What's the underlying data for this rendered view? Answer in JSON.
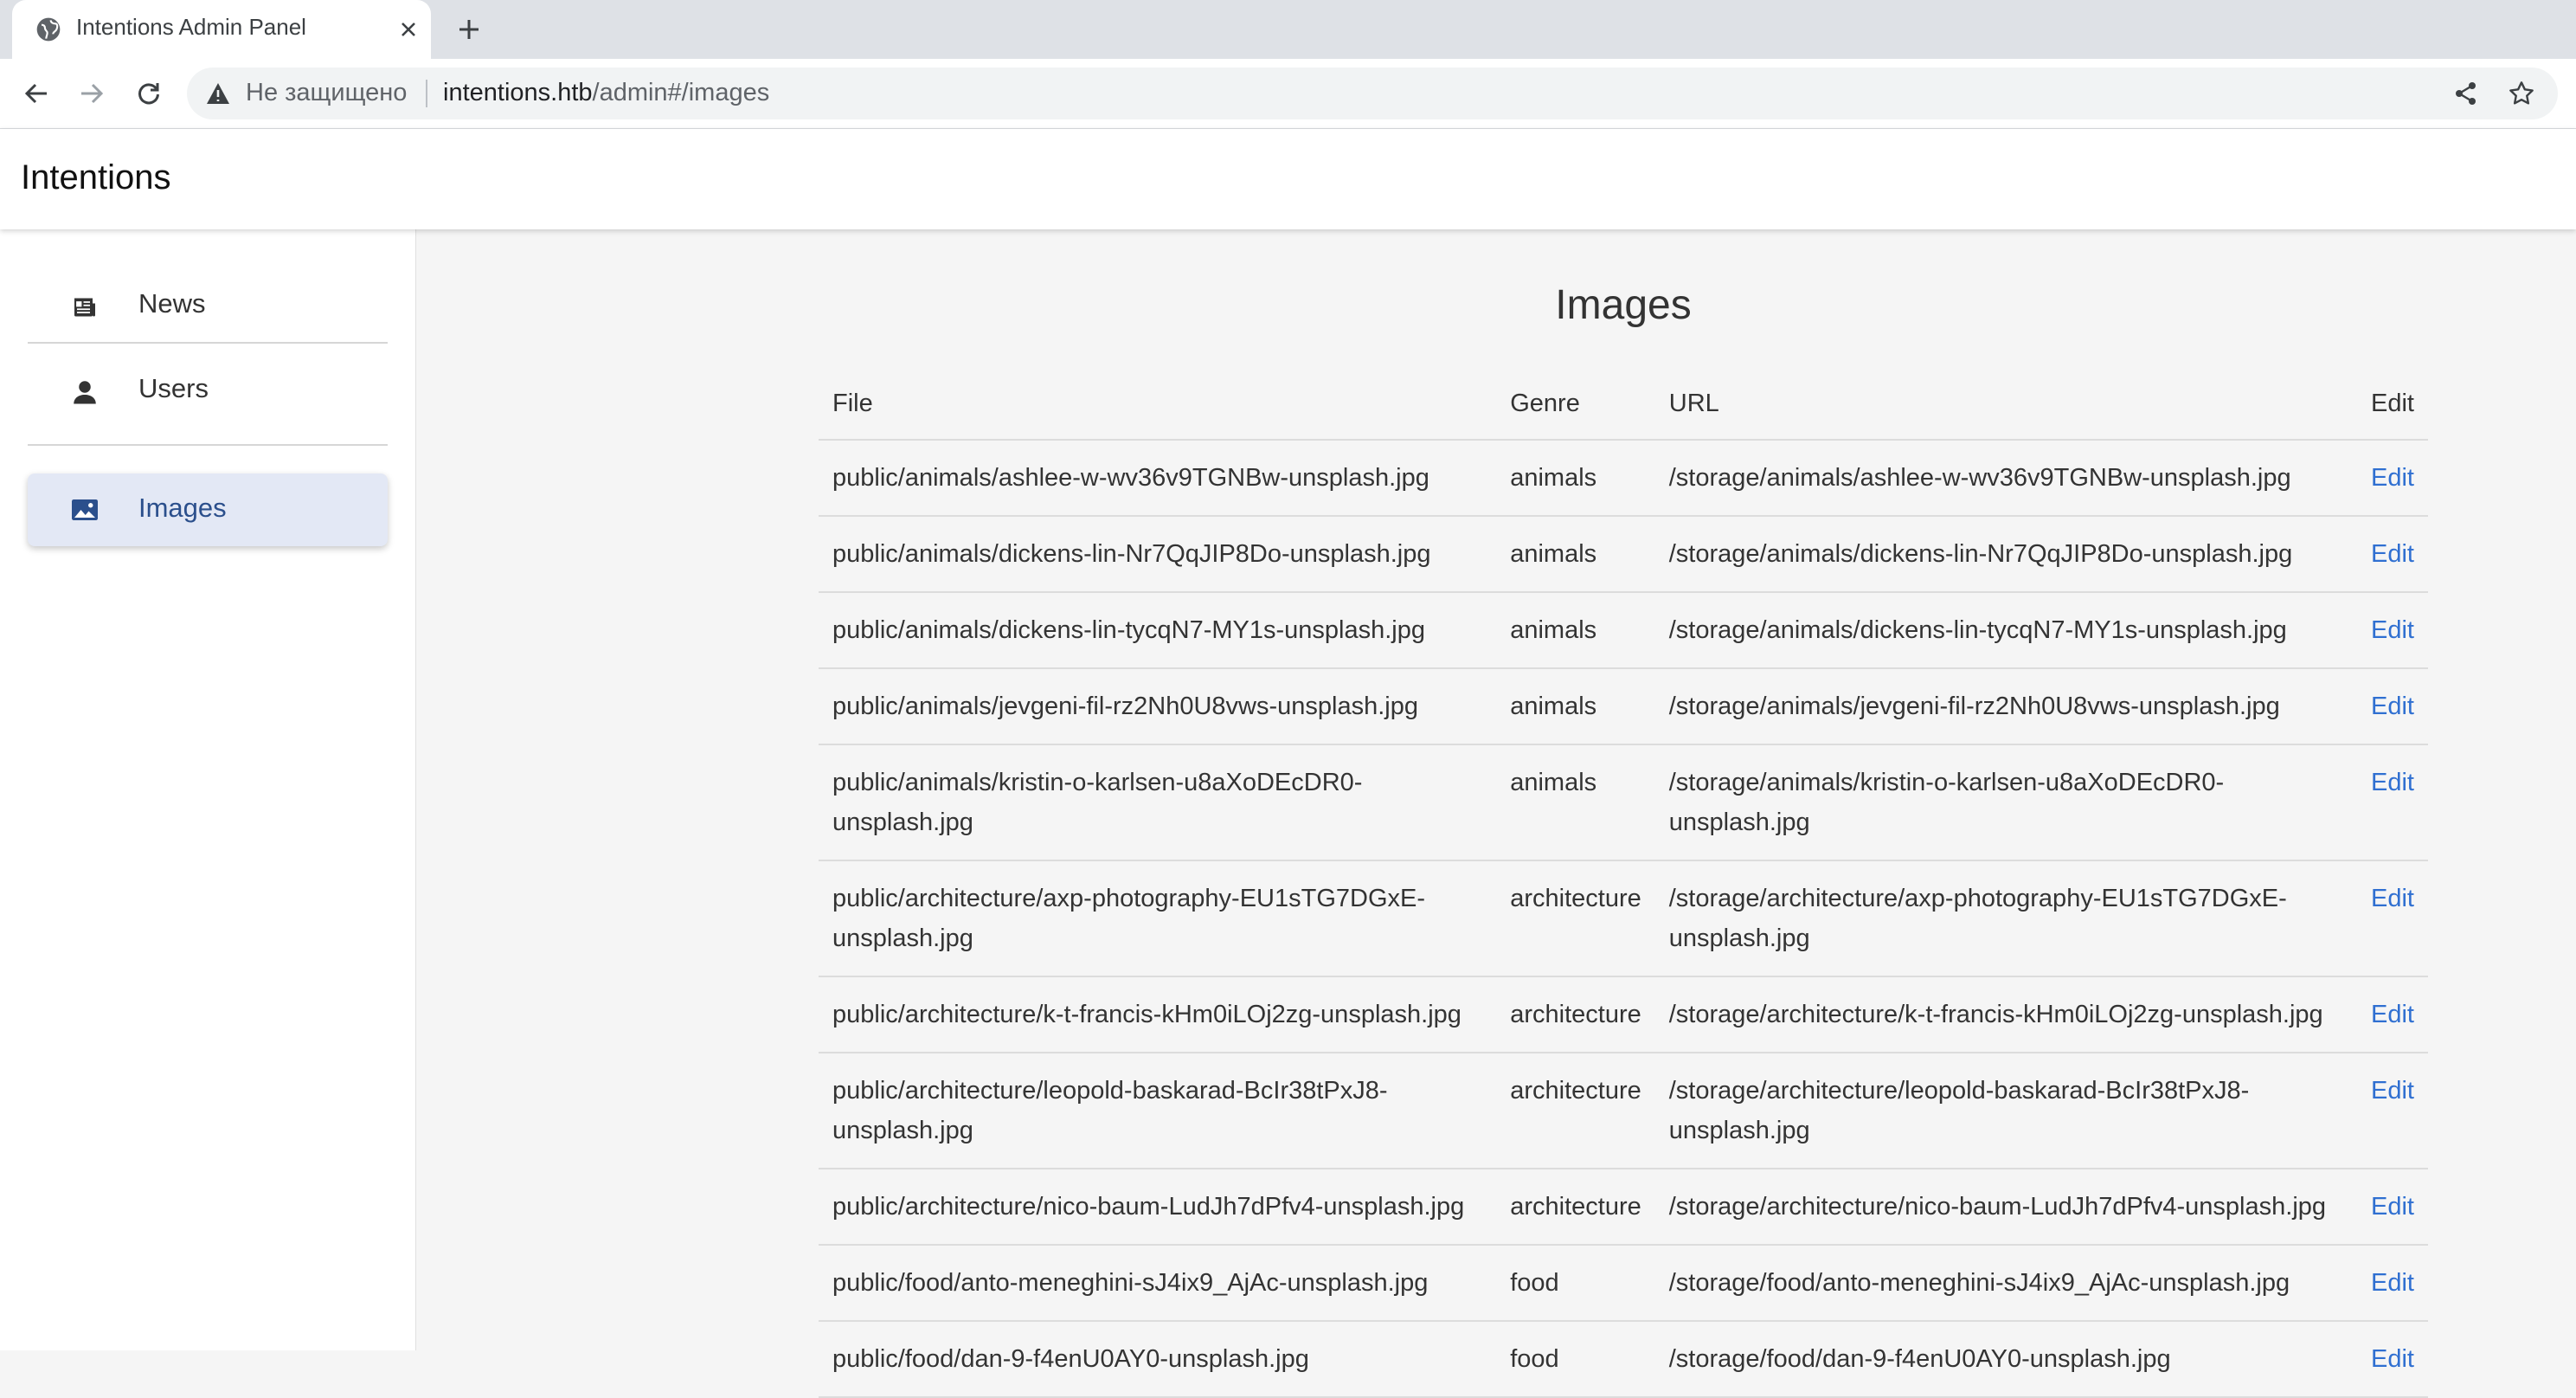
{
  "browser": {
    "tab_title": "Intentions Admin Panel",
    "security_label": "Не защищено",
    "url_host": "intentions.htb",
    "url_path": "/admin#/images"
  },
  "app": {
    "title": "Intentions"
  },
  "sidebar": {
    "items": [
      {
        "label": "News",
        "icon": "newspaper-icon",
        "active": false
      },
      {
        "label": "Users",
        "icon": "person-icon",
        "active": false
      },
      {
        "label": "Images",
        "icon": "image-icon",
        "active": true
      }
    ]
  },
  "page": {
    "title": "Images"
  },
  "table": {
    "headers": [
      "File",
      "Genre",
      "URL",
      "Edit"
    ],
    "rows": [
      {
        "file": "public/animals/ashlee-w-wv36v9TGNBw-unsplash.jpg",
        "genre": "animals",
        "url": "/storage/animals/ashlee-w-wv36v9TGNBw-unsplash.jpg",
        "edit": "Edit"
      },
      {
        "file": "public/animals/dickens-lin-Nr7QqJIP8Do-unsplash.jpg",
        "genre": "animals",
        "url": "/storage/animals/dickens-lin-Nr7QqJIP8Do-unsplash.jpg",
        "edit": "Edit"
      },
      {
        "file": "public/animals/dickens-lin-tycqN7-MY1s-unsplash.jpg",
        "genre": "animals",
        "url": "/storage/animals/dickens-lin-tycqN7-MY1s-unsplash.jpg",
        "edit": "Edit"
      },
      {
        "file": "public/animals/jevgeni-fil-rz2Nh0U8vws-unsplash.jpg",
        "genre": "animals",
        "url": "/storage/animals/jevgeni-fil-rz2Nh0U8vws-unsplash.jpg",
        "edit": "Edit"
      },
      {
        "file": "public/animals/kristin-o-karlsen-u8aXoDEcDR0-unsplash.jpg",
        "genre": "animals",
        "url": "/storage/animals/kristin-o-karlsen-u8aXoDEcDR0-unsplash.jpg",
        "edit": "Edit"
      },
      {
        "file": "public/architecture/axp-photography-EU1sTG7DGxE-unsplash.jpg",
        "genre": "architecture",
        "url": "/storage/architecture/axp-photography-EU1sTG7DGxE-unsplash.jpg",
        "edit": "Edit"
      },
      {
        "file": "public/architecture/k-t-francis-kHm0iLOj2zg-unsplash.jpg",
        "genre": "architecture",
        "url": "/storage/architecture/k-t-francis-kHm0iLOj2zg-unsplash.jpg",
        "edit": "Edit"
      },
      {
        "file": "public/architecture/leopold-baskarad-BcIr38tPxJ8-unsplash.jpg",
        "genre": "architecture",
        "url": "/storage/architecture/leopold-baskarad-BcIr38tPxJ8-unsplash.jpg",
        "edit": "Edit"
      },
      {
        "file": "public/architecture/nico-baum-LudJh7dPfv4-unsplash.jpg",
        "genre": "architecture",
        "url": "/storage/architecture/nico-baum-LudJh7dPfv4-unsplash.jpg",
        "edit": "Edit"
      },
      {
        "file": "public/food/anto-meneghini-sJ4ix9_AjAc-unsplash.jpg",
        "genre": "food",
        "url": "/storage/food/anto-meneghini-sJ4ix9_AjAc-unsplash.jpg",
        "edit": "Edit"
      },
      {
        "file": "public/food/dan-9-f4enU0AY0-unsplash.jpg",
        "genre": "food",
        "url": "/storage/food/dan-9-f4enU0AY0-unsplash.jpg",
        "edit": "Edit"
      }
    ]
  },
  "colors": {
    "link": "#2f6fd1",
    "active_nav_bg": "#e3e8f5",
    "active_nav_text": "#2b4f8c"
  }
}
